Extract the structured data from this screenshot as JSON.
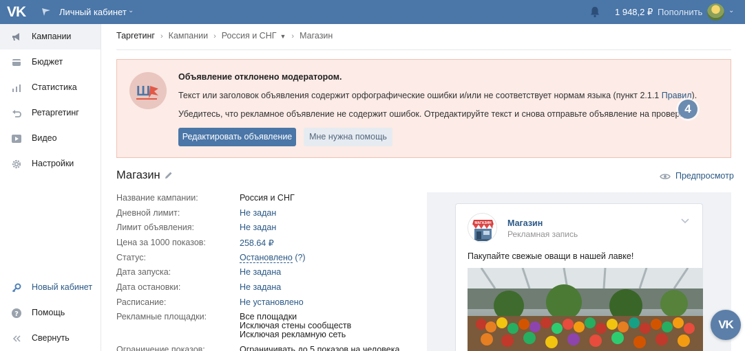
{
  "topbar": {
    "logo": "VK",
    "cabinet_title": "Личный кабинет",
    "balance": "1 948,2 ₽",
    "topup_label": "Пополнить"
  },
  "sidebar": {
    "items": [
      {
        "label": "Кампании",
        "icon": "megaphone-icon",
        "active": true
      },
      {
        "label": "Бюджет",
        "icon": "wallet-icon"
      },
      {
        "label": "Статистика",
        "icon": "bar-chart-icon"
      },
      {
        "label": "Ретаргетинг",
        "icon": "retarget-arrow-icon"
      },
      {
        "label": "Видео",
        "icon": "play-icon"
      },
      {
        "label": "Настройки",
        "icon": "gear-icon"
      }
    ],
    "bottom_items": [
      {
        "label": "Новый кабинет",
        "icon": "key-icon"
      },
      {
        "label": "Помощь",
        "icon": "help-icon"
      },
      {
        "label": "Свернуть",
        "icon": "collapse-icon"
      }
    ]
  },
  "breadcrumb": {
    "items": [
      "Таргетинг",
      "Кампании",
      "Россия и СНГ",
      "Магазин"
    ]
  },
  "alert": {
    "title": "Объявление отклонено модератором.",
    "text1": "Текст или заголовок объявления содержит орфографические ошибки и/или не соответствует нормам языка (пункт 2.1.1 ",
    "text1_link": "Правил",
    "text1_end": ").",
    "text2": "Убедитесь, что рекламное объявление не содержит ошибок. Отредактируйте текст и снова отправьте объявление на проверку.",
    "step_number": "4",
    "edit_button": "Редактировать объявление",
    "help_button": "Мне нужна помощь",
    "logo_text": "Ш"
  },
  "ad": {
    "title": "Магазин",
    "preview_label": "Предпросмотр",
    "properties": [
      {
        "label": "Название кампании:",
        "value": "Россия и СНГ",
        "style": "plain"
      },
      {
        "label": "Дневной лимит:",
        "value": "Не задан",
        "style": "link"
      },
      {
        "label": "Лимит объявления:",
        "value": "Не задан",
        "style": "link"
      },
      {
        "label": "Цена за 1000 показов:",
        "value": "258.64 ₽",
        "style": "link"
      },
      {
        "label": "Статус:",
        "value": "Остановлено",
        "extra": "(?)",
        "style": "dashed"
      },
      {
        "label": "Дата запуска:",
        "value": "Не задана",
        "style": "link"
      },
      {
        "label": "Дата остановки:",
        "value": "Не задана",
        "style": "link"
      },
      {
        "label": "Расписание:",
        "value": "Не установлено",
        "style": "link"
      },
      {
        "label": "Рекламные площадки:",
        "value": "Все площадки",
        "value2": "Исключая стены сообществ",
        "value3": "Исключая рекламную сеть",
        "style": "plain"
      },
      {
        "label": "Ограничение показов:",
        "value": "Ограничивать до 5 показов на человека",
        "style": "plain"
      }
    ]
  },
  "post": {
    "name": "Магазин",
    "subtitle": "Рекламная запись",
    "text": "Пакупайте свежые оващи в нашей лавке!",
    "avatar_sign": "МАГАЗИН"
  },
  "colors": {
    "header": "#4a76a8",
    "link": "#2a5885",
    "alert_bg": "#fcebe6",
    "alert_border": "#f0c2b4"
  }
}
